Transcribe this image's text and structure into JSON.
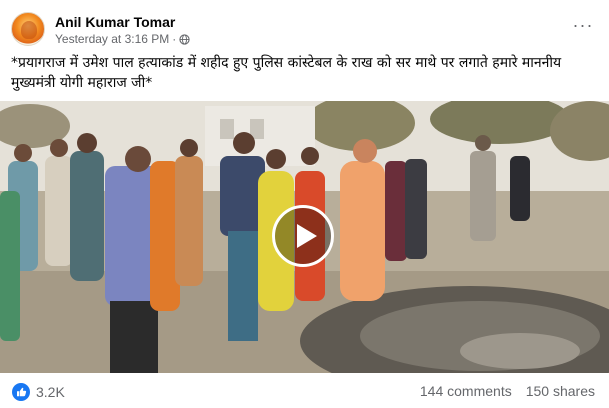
{
  "post": {
    "author": "Anil Kumar Tomar",
    "timestamp": "Yesterday at 3:16 PM",
    "separator": "·",
    "privacy_icon": "globe-icon",
    "more_icon": "more-options-icon",
    "caption": "*प्रयागराज में उमेश पाल हत्याकांड में शहीद हुए पुलिस कांस्टेबल के राख को सर माथे पर लगाते हमारे माननीय मुख्यमंत्री योगी  महाराज जी*",
    "video": {
      "play_icon": "play-icon",
      "thumbnail": "outdoor-gathering-scene"
    },
    "reactions": {
      "icon": "like-icon",
      "count": "3.2K"
    },
    "comments_label": "144 comments",
    "shares_label": "150 shares"
  },
  "colors": {
    "primary_text": "#050505",
    "secondary_text": "#65676b",
    "like_blue": "#1877f2"
  }
}
